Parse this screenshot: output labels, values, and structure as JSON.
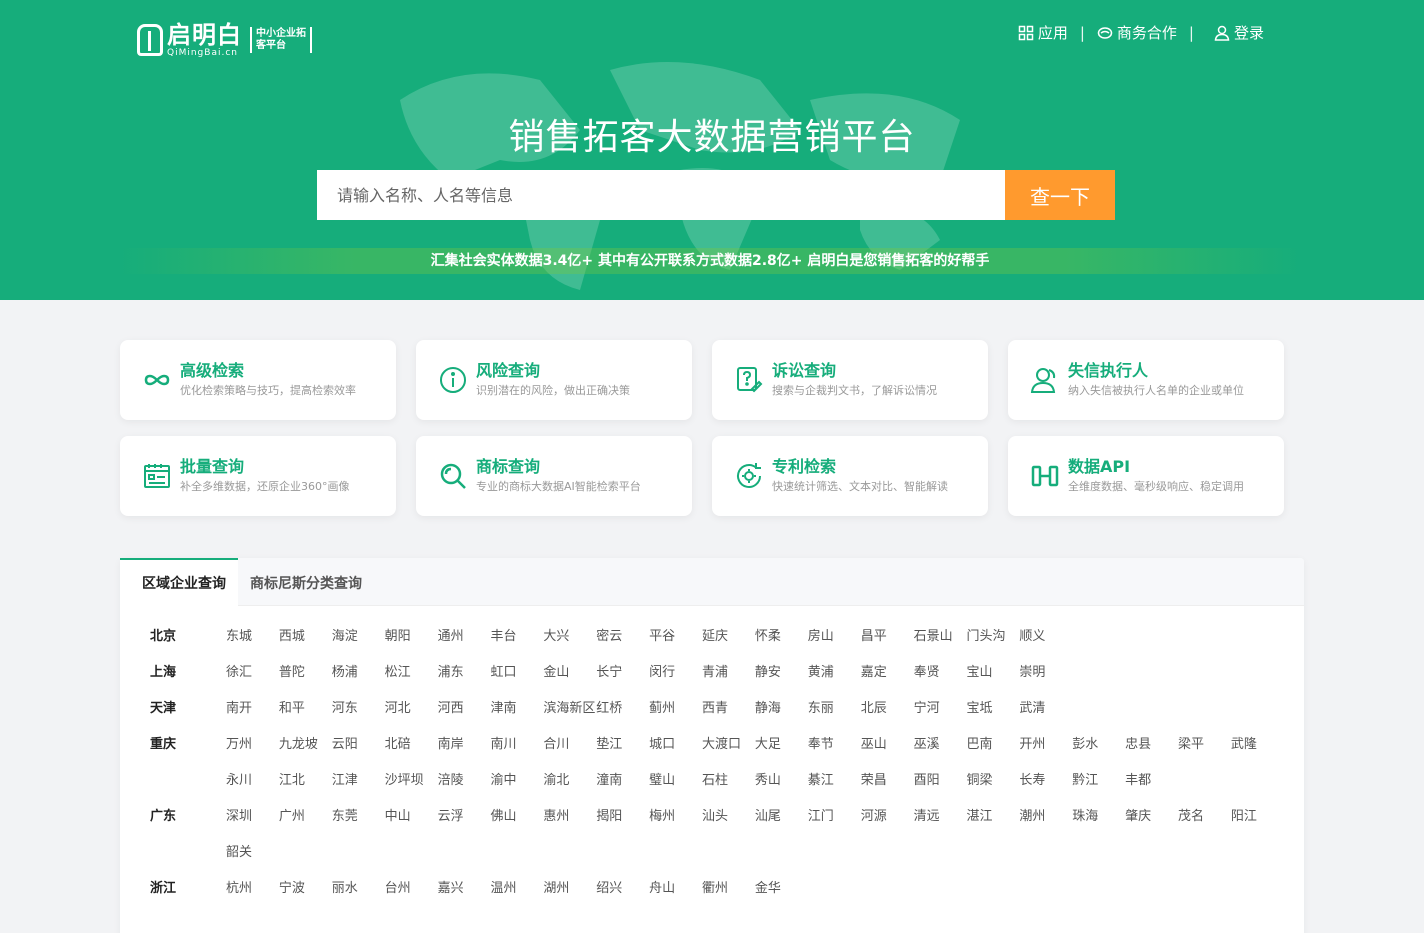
{
  "brand": {
    "name": "启明白",
    "domain": "QiMingBai.cn",
    "tag": "中小企业拓客平台"
  },
  "nav": {
    "apps": "应用",
    "business": "商务合作",
    "login": "登录",
    "separator": "|"
  },
  "hero": {
    "title": "销售拓客大数据营销平台",
    "search_placeholder": "请输入名称、人名等信息",
    "search_button": "查一下",
    "subtitle": "汇集社会实体数据3.4亿+ 其中有公开联系方式数据2.8亿+ 启明白是您销售拓客的好帮手"
  },
  "cards": [
    {
      "title": "高级检索",
      "desc": "优化检索策略与技巧，提高检索效率",
      "icon": "advanced-search-icon"
    },
    {
      "title": "风险查询",
      "desc": "识别潜在的风险，做出正确决策",
      "icon": "info-circle-icon"
    },
    {
      "title": "诉讼查询",
      "desc": "搜索与企裁判文书，了解诉讼情况",
      "icon": "lawsuit-icon"
    },
    {
      "title": "失信执行人",
      "desc": "纳入失信被执行人名单的企业或单位",
      "icon": "person-icon"
    },
    {
      "title": "批量查询",
      "desc": "补全多维数据，还原企业360°画像",
      "icon": "batch-list-icon"
    },
    {
      "title": "商标查询",
      "desc": "专业的商标大数据AI智能检索平台",
      "icon": "magnifier-icon"
    },
    {
      "title": "专利检索",
      "desc": "快速统计筛选、文本对比、智能解读",
      "icon": "patent-gear-icon"
    },
    {
      "title": "数据API",
      "desc": "全维度数据、毫秒级响应、稳定调用",
      "icon": "api-icon"
    }
  ],
  "tabs": [
    "区域企业查询",
    "商标尼斯分类查询"
  ],
  "regions": [
    {
      "name": "北京",
      "districts": [
        "东城",
        "西城",
        "海淀",
        "朝阳",
        "通州",
        "丰台",
        "大兴",
        "密云",
        "平谷",
        "延庆",
        "怀柔",
        "房山",
        "昌平",
        "石景山",
        "门头沟",
        "顺义"
      ]
    },
    {
      "name": "上海",
      "districts": [
        "徐汇",
        "普陀",
        "杨浦",
        "松江",
        "浦东",
        "虹口",
        "金山",
        "长宁",
        "闵行",
        "青浦",
        "静安",
        "黄浦",
        "嘉定",
        "奉贤",
        "宝山",
        "崇明"
      ]
    },
    {
      "name": "天津",
      "districts": [
        "南开",
        "和平",
        "河东",
        "河北",
        "河西",
        "津南",
        "滨海新区",
        "红桥",
        "蓟州",
        "西青",
        "静海",
        "东丽",
        "北辰",
        "宁河",
        "宝坻",
        "武清"
      ]
    },
    {
      "name": "重庆",
      "districts": [
        "万州",
        "九龙坡",
        "云阳",
        "北碚",
        "南岸",
        "南川",
        "合川",
        "垫江",
        "城口",
        "大渡口",
        "大足",
        "奉节",
        "巫山",
        "巫溪",
        "巴南",
        "开州",
        "彭水",
        "忠县",
        "梁平",
        "武隆",
        "永川",
        "江北",
        "江津",
        "沙坪坝",
        "涪陵",
        "渝中",
        "渝北",
        "潼南",
        "璧山",
        "石柱",
        "秀山",
        "綦江",
        "荣昌",
        "酉阳",
        "铜梁",
        "长寿",
        "黔江",
        "丰都"
      ]
    },
    {
      "name": "广东",
      "districts": [
        "深圳",
        "广州",
        "东莞",
        "中山",
        "云浮",
        "佛山",
        "惠州",
        "揭阳",
        "梅州",
        "汕头",
        "汕尾",
        "江门",
        "河源",
        "清远",
        "湛江",
        "潮州",
        "珠海",
        "肇庆",
        "茂名",
        "阳江",
        "韶关"
      ]
    },
    {
      "name": "浙江",
      "districts": [
        "杭州",
        "宁波",
        "丽水",
        "台州",
        "嘉兴",
        "温州",
        "湖州",
        "绍兴",
        "舟山",
        "衢州",
        "金华"
      ]
    }
  ]
}
